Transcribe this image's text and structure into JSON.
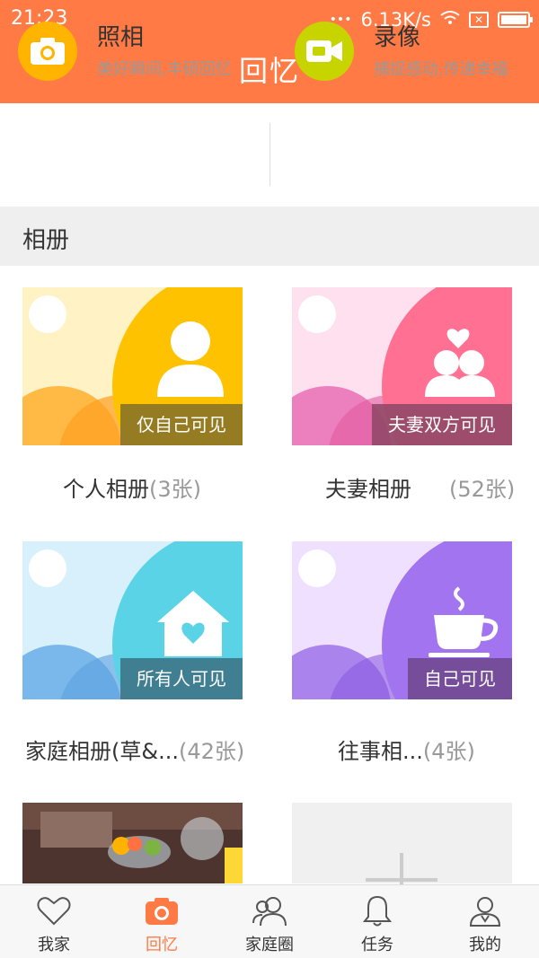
{
  "status_bar": {
    "time": "21:23",
    "network_speed": "6.13K/s",
    "signal_dots": "•••"
  },
  "header": {
    "title": "回忆"
  },
  "quick_actions": [
    {
      "title": "照相",
      "subtitle": "美好瞬间,丰硕回忆",
      "icon": "camera-icon",
      "color": "#ffb400"
    },
    {
      "title": "录像",
      "subtitle": "捕捉感动,传递幸福",
      "icon": "video-camera-icon",
      "color": "#c8d400"
    }
  ],
  "section_title": "相册",
  "albums": [
    {
      "name": "个人相册",
      "count": "(3张)",
      "visibility": "仅自己可见",
      "icon": "person-icon"
    },
    {
      "name": "夫妻相册",
      "count": "(52张)",
      "visibility": "夫妻双方可见",
      "icon": "couple-heart-icon"
    },
    {
      "name": "家庭相册(草&...",
      "count": "(42张)",
      "visibility": "所有人可见",
      "icon": "house-heart-icon"
    },
    {
      "name": "往事相...",
      "count": "(4张)",
      "visibility": "自己可见",
      "icon": "coffee-cup-icon"
    }
  ],
  "tabs": [
    {
      "label": "我家",
      "icon": "heart-icon",
      "active": false
    },
    {
      "label": "回忆",
      "icon": "camera-icon",
      "active": true
    },
    {
      "label": "家庭圈",
      "icon": "people-icon",
      "active": false
    },
    {
      "label": "任务",
      "icon": "bell-icon",
      "active": false
    },
    {
      "label": "我的",
      "icon": "user-icon",
      "active": false
    }
  ],
  "colors": {
    "accent": "#ff7a45",
    "album_personal": "#ffc200",
    "album_couple": "#ff7092",
    "album_family": "#5ad3e6",
    "album_past": "#a374f0"
  }
}
